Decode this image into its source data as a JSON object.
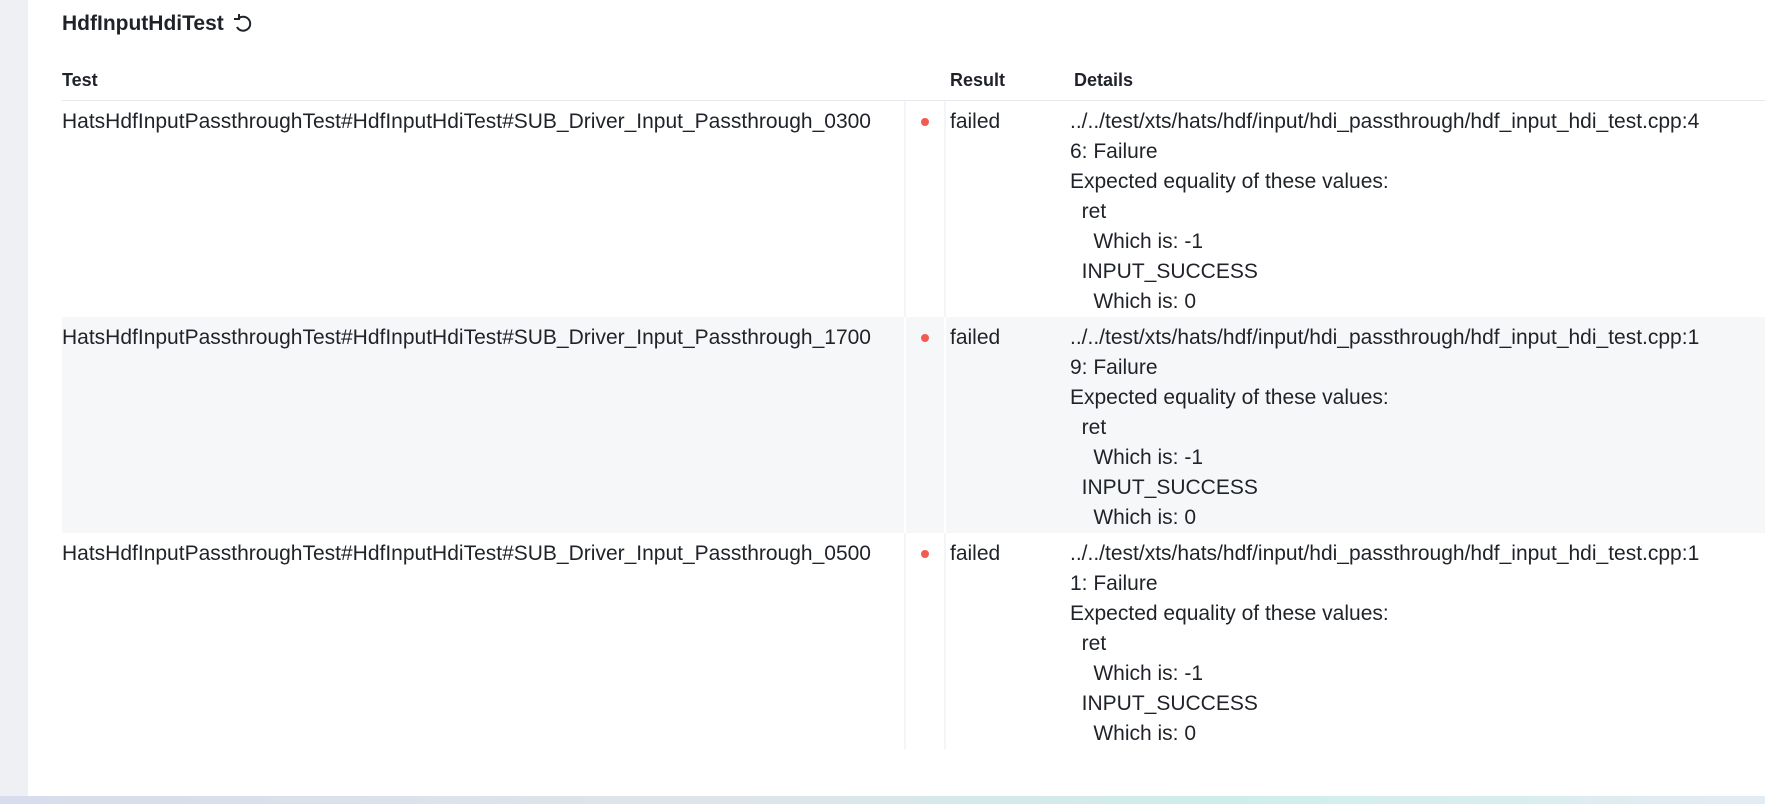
{
  "title": "HdfInputHdiTest",
  "columns": {
    "test": "Test",
    "result": "Result",
    "details": "Details"
  },
  "rows": [
    {
      "test": "HatsHdfInputPassthroughTest#HdfInputHdiTest#SUB_Driver_Input_Passthrough_0300",
      "result": "failed",
      "details": "../../test/xts/hats/hdf/input/hdi_passthrough/hdf_input_hdi_test.cpp:4\n6: Failure\nExpected equality of these values:\n  ret\n    Which is: -1\n  INPUT_SUCCESS\n    Which is: 0"
    },
    {
      "test": "HatsHdfInputPassthroughTest#HdfInputHdiTest#SUB_Driver_Input_Passthrough_1700",
      "result": "failed",
      "details": "../../test/xts/hats/hdf/input/hdi_passthrough/hdf_input_hdi_test.cpp:1\n9: Failure\nExpected equality of these values:\n  ret\n    Which is: -1\n  INPUT_SUCCESS\n    Which is: 0"
    },
    {
      "test": "HatsHdfInputPassthroughTest#HdfInputHdiTest#SUB_Driver_Input_Passthrough_0500",
      "result": "failed",
      "details": "../../test/xts/hats/hdf/input/hdi_passthrough/hdf_input_hdi_test.cpp:1\n1: Failure\nExpected equality of these values:\n  ret\n    Which is: -1\n  INPUT_SUCCESS\n    Which is: 0"
    }
  ],
  "colors": {
    "failed_dot": "#f25a52",
    "alt_row": "#f6f7f9"
  }
}
